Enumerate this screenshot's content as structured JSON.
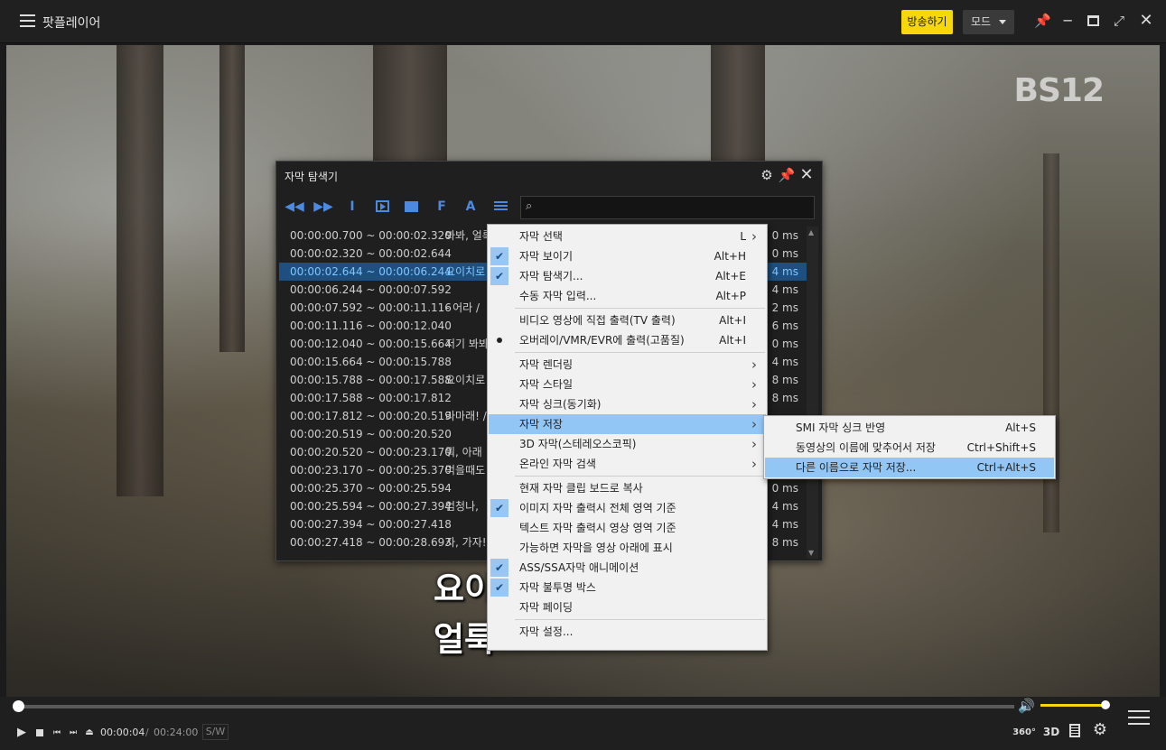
{
  "app": {
    "title": "팟플레이어",
    "broadcast_label": "방송하기",
    "mode_label": "모드",
    "icons": {
      "pin": "pin-icon",
      "minimize": "minimize-icon",
      "maximize": "maximize-icon",
      "fullscreen": "fullscreen-icon",
      "close": "close-icon"
    }
  },
  "video": {
    "channel_logo": "BS12",
    "subtitle_lines": [
      "요이",
      "얼룩"
    ]
  },
  "explorer": {
    "title": "자막 탐색기",
    "search_placeholder": "",
    "toolbar": [
      "◀◀",
      "▶▶",
      "I",
      "▶",
      "■",
      "F",
      "A",
      "≡"
    ],
    "rows": [
      {
        "time": "00:00:00.700 ~ 00:00:02.320",
        "text": "봐봐, 얼룩",
        "dur": "0 ms"
      },
      {
        "time": "00:00:02.320 ~ 00:00:02.644",
        "text": "",
        "dur": "0 ms"
      },
      {
        "time": "00:00:02.644 ~ 00:00:06.244",
        "text": "요이치로",
        "dur": "4 ms",
        "selected": true
      },
      {
        "time": "00:00:06.244 ~ 00:00:07.592",
        "text": "",
        "dur": "4 ms"
      },
      {
        "time": "00:00:07.592 ~ 00:00:11.116",
        "text": "- 어라 /",
        "dur": "2 ms"
      },
      {
        "time": "00:00:11.116 ~ 00:00:12.040",
        "text": "",
        "dur": "6 ms"
      },
      {
        "time": "00:00:12.040 ~ 00:00:15.664",
        "text": "저기 봐봐",
        "dur": "0 ms"
      },
      {
        "time": "00:00:15.664 ~ 00:00:15.788",
        "text": "",
        "dur": "4 ms"
      },
      {
        "time": "00:00:15.788 ~ 00:00:17.588",
        "text": "요이치로",
        "dur": "8 ms"
      },
      {
        "time": "00:00:17.588 ~ 00:00:17.812",
        "text": "",
        "dur": "8 ms"
      },
      {
        "time": "00:00:17.812 ~ 00:00:20.519",
        "text": "라마래! /",
        "dur": ""
      },
      {
        "time": "00:00:20.519 ~ 00:00:20.520",
        "text": "",
        "dur": ""
      },
      {
        "time": "00:00:20.520 ~ 00:00:23.170",
        "text": "뭐, 아래",
        "dur": ""
      },
      {
        "time": "00:00:23.170 ~ 00:00:25.370",
        "text": "먹을때도",
        "dur": ""
      },
      {
        "time": "00:00:25.370 ~ 00:00:25.594",
        "text": "",
        "dur": "0 ms"
      },
      {
        "time": "00:00:25.594 ~ 00:00:27.394",
        "text": "엄청나,",
        "dur": "4 ms"
      },
      {
        "time": "00:00:27.394 ~ 00:00:27.418",
        "text": "",
        "dur": "4 ms"
      },
      {
        "time": "00:00:27.418 ~ 00:00:28.693",
        "text": "자, 가자!",
        "dur": "8 ms"
      }
    ]
  },
  "context_menu": {
    "items": [
      {
        "label": "자막 선택",
        "shortcut": "L",
        "arrow": true
      },
      {
        "label": "자막 보이기",
        "shortcut": "Alt+H",
        "check": true
      },
      {
        "label": "자막 탐색기...",
        "shortcut": "Alt+E",
        "check": true
      },
      {
        "label": "수동 자막 입력...",
        "shortcut": "Alt+P"
      },
      {
        "label": "비디오 영상에 직접 출력(TV 출력)",
        "shortcut": "Alt+I",
        "sep_before": true
      },
      {
        "label": "오버레이/VMR/EVR에 출력(고품질)",
        "shortcut": "Alt+I",
        "dot": true
      },
      {
        "label": "자막 렌더링",
        "arrow": true,
        "sep_before": true
      },
      {
        "label": "자막 스타일",
        "arrow": true
      },
      {
        "label": "자막 싱크(동기화)",
        "arrow": true
      },
      {
        "label": "자막 저장",
        "arrow": true,
        "highlight": true
      },
      {
        "label": "3D 자막(스테레오스코픽)",
        "arrow": true
      },
      {
        "label": "온라인 자막 검색",
        "arrow": true
      },
      {
        "label": "현재 자막 클립 보드로 복사",
        "sep_before": true
      },
      {
        "label": "이미지 자막 출력시 전체 영역 기준",
        "check": true
      },
      {
        "label": "텍스트 자막 출력시 영상 영역 기준"
      },
      {
        "label": "가능하면 자막을 영상 아래에 표시"
      },
      {
        "label": "ASS/SSA자막 애니메이션",
        "check": true
      },
      {
        "label": "자막 불투명 박스",
        "check": true
      },
      {
        "label": "자막 페이딩"
      },
      {
        "label": "자막 설정...",
        "sep_before": true
      }
    ]
  },
  "submenu": {
    "items": [
      {
        "label": "SMI 자막 싱크 반영",
        "shortcut": "Alt+S"
      },
      {
        "label": "동영상의 이름에 맞추어서 저장",
        "shortcut": "Ctrl+Shift+S"
      },
      {
        "label": "다른 이름으로 자막 저장...",
        "shortcut": "Ctrl+Alt+S",
        "highlight": true
      }
    ]
  },
  "controls": {
    "current_time": "00:00:04",
    "time_separator": "/",
    "total_time": "00:24:00",
    "sw_badge": "S/W",
    "progress_fraction": 0.003,
    "volume_fraction": 1.0,
    "label_360": "360°",
    "label_3d": "3D",
    "accent_color": "#f6d70a"
  }
}
